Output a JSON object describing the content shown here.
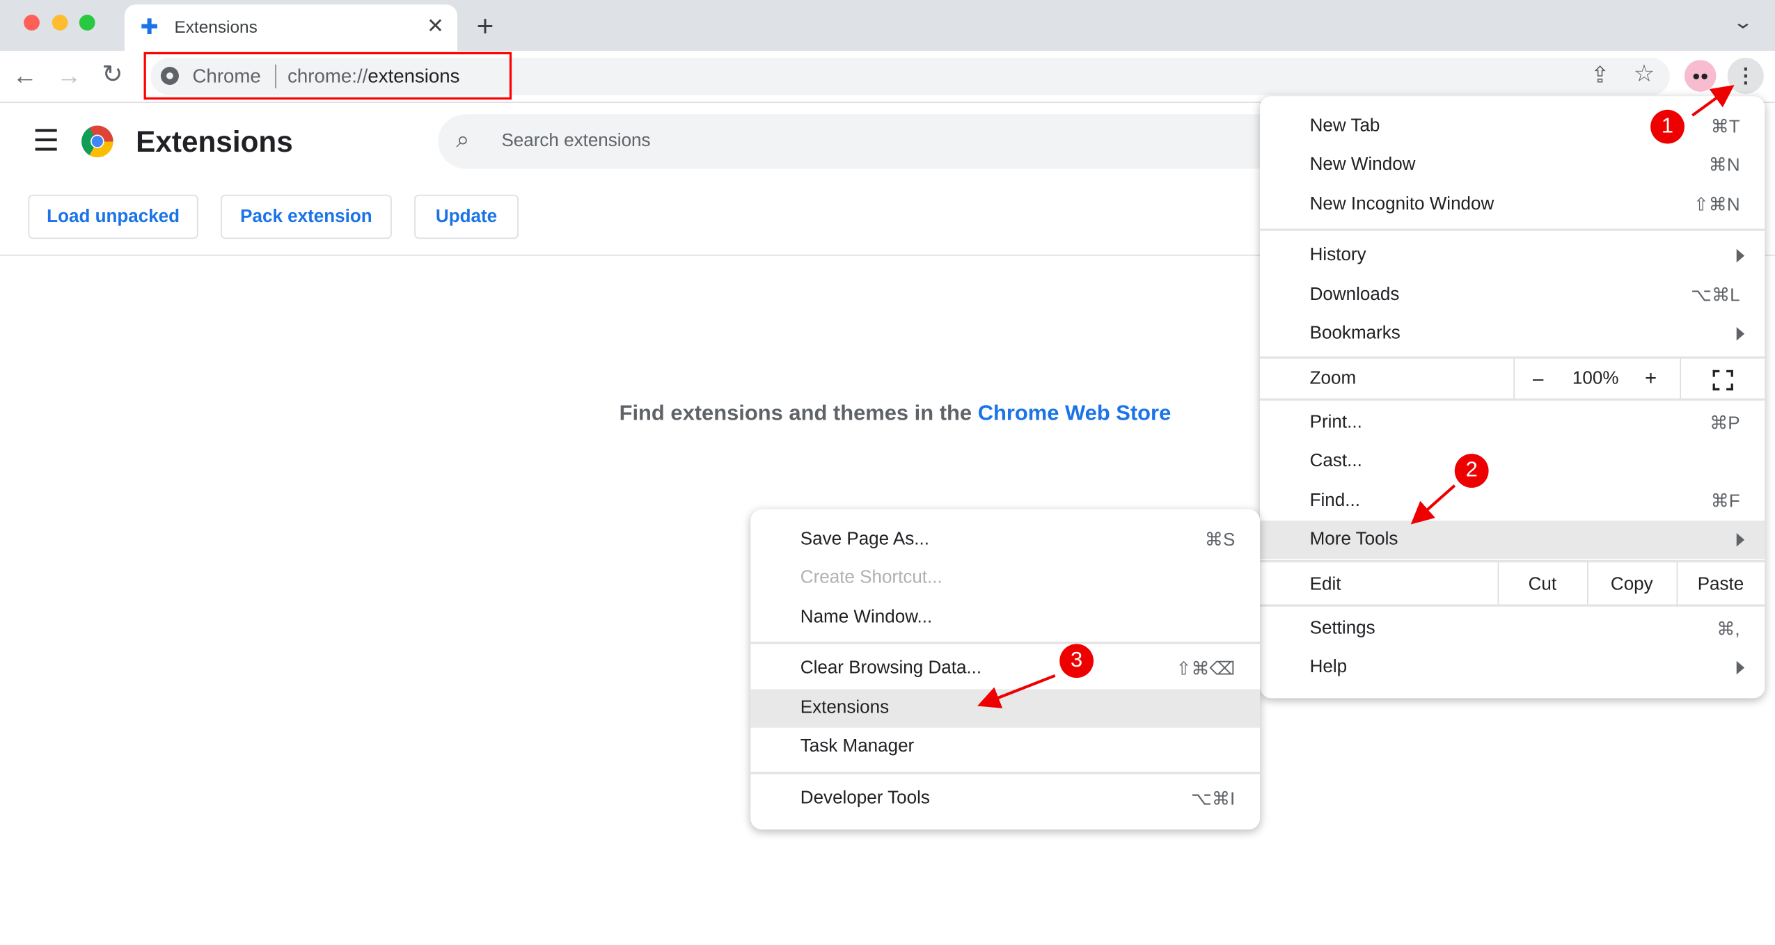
{
  "tab": {
    "title": "Extensions",
    "icon": "puzzle-icon"
  },
  "omnibox": {
    "site_label": "Chrome",
    "url_prefix": "chrome://",
    "url_path": "extensions"
  },
  "header": {
    "title": "Extensions",
    "search_placeholder": "Search extensions"
  },
  "actions": {
    "load_unpacked": "Load unpacked",
    "pack_extension": "Pack extension",
    "update": "Update"
  },
  "body": {
    "prompt": "Find extensions and themes in the ",
    "link": "Chrome Web Store"
  },
  "main_menu": {
    "new_tab": {
      "label": "New Tab",
      "shortcut": "⌘T"
    },
    "new_window": {
      "label": "New Window",
      "shortcut": "⌘N"
    },
    "incognito": {
      "label": "New Incognito Window",
      "shortcut": "⇧⌘N"
    },
    "history": {
      "label": "History"
    },
    "downloads": {
      "label": "Downloads",
      "shortcut": "⌥⌘L"
    },
    "bookmarks": {
      "label": "Bookmarks"
    },
    "zoom": {
      "label": "Zoom",
      "minus": "–",
      "value": "100%",
      "plus": "+"
    },
    "print": {
      "label": "Print...",
      "shortcut": "⌘P"
    },
    "cast": {
      "label": "Cast..."
    },
    "find": {
      "label": "Find...",
      "shortcut": "⌘F"
    },
    "more_tools": {
      "label": "More Tools"
    },
    "edit": {
      "label": "Edit",
      "cut": "Cut",
      "copy": "Copy",
      "paste": "Paste"
    },
    "settings": {
      "label": "Settings",
      "shortcut": "⌘,"
    },
    "help": {
      "label": "Help"
    }
  },
  "submenu": {
    "save_page": {
      "label": "Save Page As...",
      "shortcut": "⌘S"
    },
    "create_shortcut": {
      "label": "Create Shortcut..."
    },
    "name_window": {
      "label": "Name Window..."
    },
    "clear_data": {
      "label": "Clear Browsing Data...",
      "shortcut": "⇧⌘⌫"
    },
    "extensions": {
      "label": "Extensions"
    },
    "task_manager": {
      "label": "Task Manager"
    },
    "dev_tools": {
      "label": "Developer Tools",
      "shortcut": "⌥⌘I"
    }
  },
  "annotations": {
    "step1": "1",
    "step2": "2",
    "step3": "3",
    "color": "#ee0000"
  },
  "colors": {
    "accent": "#1a73e8",
    "highlight": "#e8e8e8"
  }
}
